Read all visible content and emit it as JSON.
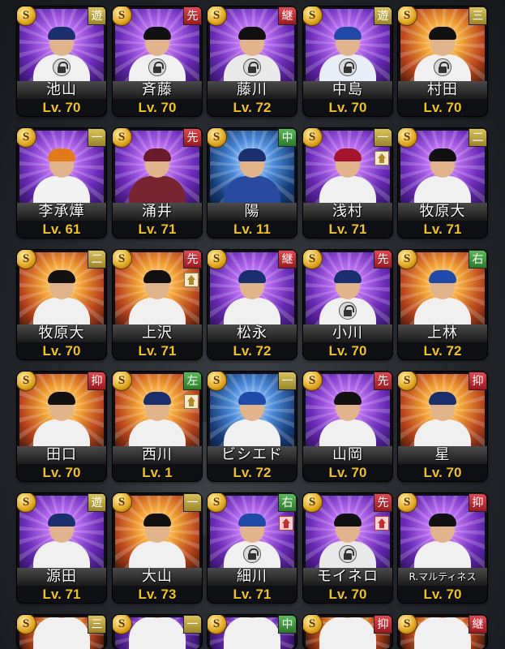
{
  "rows": [
    [
      {
        "name": "池山",
        "level": "Lv. 70",
        "position": "遊",
        "pos_color": "gold",
        "lock": true,
        "up": false,
        "bg": "purple",
        "cap": "#1a2f6e",
        "jersey": "#f0f0f0"
      },
      {
        "name": "斉藤",
        "level": "Lv. 70",
        "position": "先",
        "pos_color": "red",
        "lock": true,
        "up": false,
        "bg": "purple",
        "cap": "#111111",
        "jersey": "#f0f0f0"
      },
      {
        "name": "藤川",
        "level": "Lv. 72",
        "position": "継",
        "pos_color": "red",
        "lock": true,
        "up": false,
        "bg": "purple",
        "cap": "#111111",
        "jersey": "#e9e9e9"
      },
      {
        "name": "中島",
        "level": "Lv. 70",
        "position": "遊",
        "pos_color": "gold",
        "lock": true,
        "up": false,
        "bg": "purple",
        "cap": "#1f4aa8",
        "jersey": "#e8eef8"
      },
      {
        "name": "村田",
        "level": "Lv. 70",
        "position": "三",
        "pos_color": "gold",
        "lock": true,
        "up": false,
        "bg": "gold",
        "cap": "#111111",
        "jersey": "#f0f0f0"
      }
    ],
    [
      {
        "name": "李承燁",
        "level": "Lv. 61",
        "position": "一",
        "pos_color": "gold",
        "lock": false,
        "up": false,
        "bg": "purple",
        "cap": "#e07a1a",
        "jersey": "#f3f3f3"
      },
      {
        "name": "涌井",
        "level": "Lv. 71",
        "position": "先",
        "pos_color": "red",
        "lock": false,
        "up": false,
        "bg": "purple",
        "cap": "#6a1a2a",
        "jersey": "#7a2430"
      },
      {
        "name": "陽",
        "level": "Lv. 11",
        "position": "中",
        "pos_color": "green",
        "lock": false,
        "up": false,
        "bg": "blue",
        "cap": "#1a2f6e",
        "jersey": "#2a4aa0"
      },
      {
        "name": "浅村",
        "level": "Lv. 71",
        "position": "一",
        "pos_color": "gold",
        "lock": false,
        "up": true,
        "up_color": "gold",
        "bg": "purple",
        "cap": "#a5142a",
        "jersey": "#f0f0f0"
      },
      {
        "name": "牧原大",
        "level": "Lv. 71",
        "position": "二",
        "pos_color": "gold",
        "lock": false,
        "up": false,
        "bg": "purple",
        "cap": "#111111",
        "jersey": "#f0f0f0"
      }
    ],
    [
      {
        "name": "牧原大",
        "level": "Lv. 70",
        "position": "二",
        "pos_color": "gold",
        "lock": false,
        "up": false,
        "bg": "gold",
        "cap": "#111111",
        "jersey": "#f0f0f0"
      },
      {
        "name": "上沢",
        "level": "Lv. 71",
        "position": "先",
        "pos_color": "red",
        "lock": false,
        "up": true,
        "up_color": "gold",
        "bg": "gold",
        "cap": "#111111",
        "jersey": "#f0f0f0"
      },
      {
        "name": "松永",
        "level": "Lv. 72",
        "position": "継",
        "pos_color": "red",
        "lock": false,
        "up": false,
        "bg": "purple",
        "cap": "#1a2f6e",
        "jersey": "#f0f0f0"
      },
      {
        "name": "小川",
        "level": "Lv. 70",
        "position": "先",
        "pos_color": "red",
        "lock": true,
        "up": false,
        "bg": "purple",
        "cap": "#1a2f6e",
        "jersey": "#f0f0f0"
      },
      {
        "name": "上林",
        "level": "Lv. 72",
        "position": "右",
        "pos_color": "green",
        "lock": false,
        "up": false,
        "bg": "gold",
        "cap": "#1f4aa8",
        "jersey": "#f0f0f0"
      }
    ],
    [
      {
        "name": "田口",
        "level": "Lv. 70",
        "position": "抑",
        "pos_color": "red",
        "lock": false,
        "up": false,
        "bg": "gold",
        "cap": "#111111",
        "jersey": "#f0f0f0"
      },
      {
        "name": "西川",
        "level": "Lv. 1",
        "position": "左",
        "pos_color": "green",
        "lock": false,
        "up": true,
        "up_color": "gold",
        "bg": "gold",
        "cap": "#1a2f6e",
        "jersey": "#f0f0f0"
      },
      {
        "name": "ビシエド",
        "level": "Lv. 72",
        "position": "一",
        "pos_color": "gold",
        "lock": false,
        "up": false,
        "bg": "blue",
        "cap": "#1f4aa8",
        "jersey": "#f0f0f0"
      },
      {
        "name": "山岡",
        "level": "Lv. 70",
        "position": "先",
        "pos_color": "red",
        "lock": false,
        "up": false,
        "bg": "purple",
        "cap": "#111111",
        "jersey": "#f0f0f0"
      },
      {
        "name": "星",
        "level": "Lv. 70",
        "position": "抑",
        "pos_color": "red",
        "lock": false,
        "up": false,
        "bg": "gold",
        "cap": "#1a2f6e",
        "jersey": "#f0f0f0"
      }
    ],
    [
      {
        "name": "源田",
        "level": "Lv. 71",
        "position": "遊",
        "pos_color": "gold",
        "lock": false,
        "up": false,
        "bg": "purple",
        "cap": "#1a2f6e",
        "jersey": "#f0f0f0"
      },
      {
        "name": "大山",
        "level": "Lv. 73",
        "position": "一",
        "pos_color": "gold",
        "lock": false,
        "up": false,
        "bg": "gold",
        "cap": "#111111",
        "jersey": "#f0f0f0"
      },
      {
        "name": "細川",
        "level": "Lv. 71",
        "position": "右",
        "pos_color": "green",
        "lock": true,
        "up": true,
        "up_color": "red",
        "bg": "purple",
        "cap": "#1f4aa8",
        "jersey": "#f0f0f0"
      },
      {
        "name": "モイネロ",
        "level": "Lv. 70",
        "position": "先",
        "pos_color": "red",
        "lock": true,
        "up": true,
        "up_color": "red",
        "bg": "purple",
        "cap": "#111111",
        "jersey": "#e9e9e9"
      },
      {
        "name": "R.マルティネス",
        "level": "Lv. 70",
        "position": "抑",
        "pos_color": "red",
        "lock": false,
        "up": false,
        "bg": "purple",
        "cap": "#111111",
        "jersey": "#f0f0f0"
      }
    ],
    [
      {
        "name": "",
        "level": "",
        "position": "三",
        "pos_color": "gold",
        "lock": false,
        "up": false,
        "bg": "gold",
        "cap": "#111111",
        "jersey": "#f0f0f0"
      },
      {
        "name": "",
        "level": "",
        "position": "一",
        "pos_color": "gold",
        "lock": false,
        "up": false,
        "bg": "purple",
        "cap": "#1f6ad0",
        "jersey": "#f0f0f0"
      },
      {
        "name": "",
        "level": "",
        "position": "中",
        "pos_color": "green",
        "lock": false,
        "up": false,
        "bg": "purple",
        "cap": "#1a2f6e",
        "jersey": "#f0f0f0"
      },
      {
        "name": "",
        "level": "",
        "position": "抑",
        "pos_color": "red",
        "lock": false,
        "up": false,
        "bg": "gold",
        "cap": "#1a2f6e",
        "jersey": "#f0f0f0"
      },
      {
        "name": "",
        "level": "",
        "position": "継",
        "pos_color": "red",
        "lock": false,
        "up": false,
        "bg": "gold",
        "cap": "#1f6ad0",
        "jersey": "#f0f0f0"
      }
    ]
  ],
  "badge_letter": "S"
}
